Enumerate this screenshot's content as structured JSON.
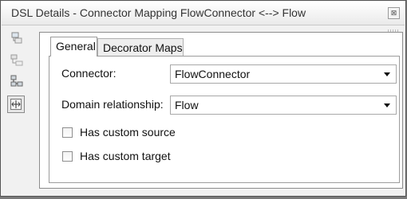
{
  "window": {
    "title": "DSL Details - Connector Mapping FlowConnector <--> Flow",
    "close_label": "⊠"
  },
  "toolbar": {
    "icons": [
      "mapping-tree-icon",
      "class-tree-icon",
      "hierarchy-icon",
      "connector-mapping-icon"
    ]
  },
  "tabs": [
    {
      "label": "General"
    },
    {
      "label": "Decorator Maps"
    }
  ],
  "general": {
    "connector_label": "Connector:",
    "connector_value": "FlowConnector",
    "domain_relationship_label": "Domain relationship:",
    "domain_relationship_value": "Flow",
    "has_custom_source_label": "Has custom source",
    "has_custom_target_label": "Has custom target"
  }
}
